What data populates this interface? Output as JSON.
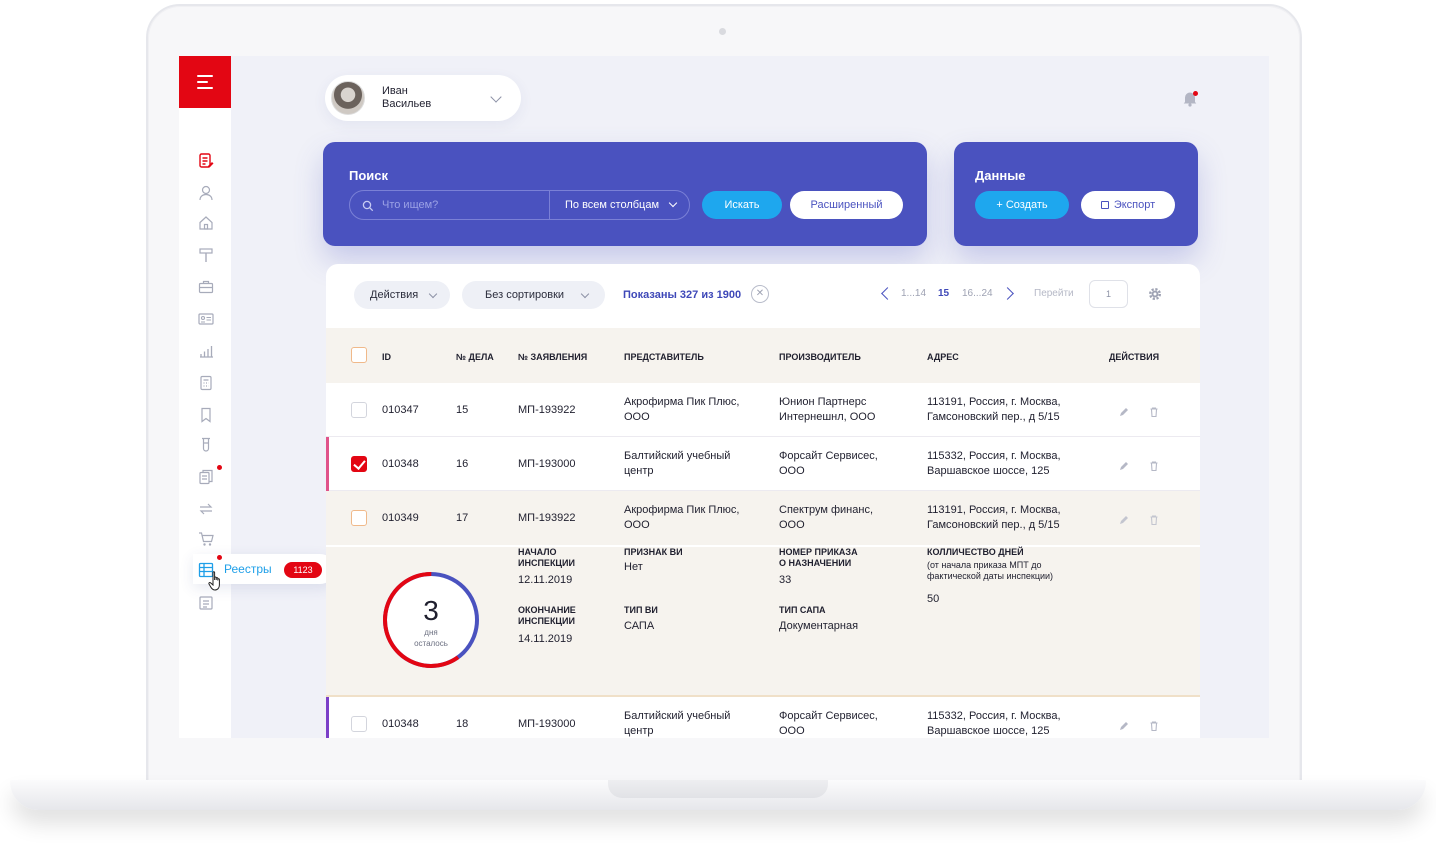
{
  "user": {
    "first_name": "Иван",
    "last_name": "Васильев"
  },
  "sidebar": {
    "active_label": "Реестры",
    "active_badge": "1123",
    "icons": [
      "document-edit-icon",
      "user-icon",
      "home-icon",
      "hammer-icon",
      "briefcase-icon",
      "id-card-icon",
      "bar-chart-icon",
      "calculator-icon",
      "bookmark-icon",
      "test-tube-icon",
      "documents-icon",
      "exchange-icon",
      "cart-icon",
      "registry-icon",
      "list-icon"
    ]
  },
  "search": {
    "title": "Поиск",
    "placeholder": "Что ищем?",
    "scope": "По всем столбцам",
    "find_label": "Искать",
    "advanced_label": "Расширенный"
  },
  "data_card": {
    "title": "Данные",
    "create_label": "+ Создать",
    "export_label": "Экспорт"
  },
  "toolbar": {
    "actions_label": "Действия",
    "sort_label": "Без сортировки",
    "shown_text": "Показаны 327 из 1900",
    "pages_before": "1...14",
    "current_page": "15",
    "pages_after": "16...24",
    "goto_label": "Перейти",
    "goto_value": "1"
  },
  "table": {
    "headers": [
      "ID",
      "№ ДЕЛА",
      "№ ЗАЯВЛЕНИЯ",
      "ПРЕДСТАВИТЕЛЬ",
      "ПРОИЗВОДИТЕЛЬ",
      "АДРЕС",
      "ДЕЙСТВИЯ"
    ],
    "rows": [
      {
        "id": "010347",
        "case": "15",
        "app": "МП-193922",
        "rep": [
          "Акрофирма Пик Плюс,",
          "ООО"
        ],
        "maker": [
          "Юнион Партнерс",
          "Интернешнл, ООО"
        ],
        "addr": [
          "113191, Россия, г. Москва,",
          "Гамсоновский пер., д 5/15"
        ]
      },
      {
        "id": "010348",
        "case": "16",
        "app": "МП-193000",
        "rep": [
          "Балтийский учебный",
          "центр"
        ],
        "maker": [
          "Форсайт Сервисес,",
          "ООО"
        ],
        "addr": [
          "115332, Россия, г. Москва,",
          "Варшавское шоссе, 125"
        ]
      },
      {
        "id": "010349",
        "case": "17",
        "app": "МП-193922",
        "rep": [
          "Акрофирма Пик Плюс,",
          "ООО"
        ],
        "maker": [
          "Спектрум финанс,",
          "ООО"
        ],
        "addr": [
          "113191, Россия, г. Москва,",
          "Гамсоновский пер., д 5/15"
        ]
      },
      {
        "id": "010348",
        "case": "18",
        "app": "МП-193000",
        "rep": [
          "Балтийский учебный",
          "центр"
        ],
        "maker": [
          "Форсайт Сервисес,",
          "ООО"
        ],
        "addr": [
          "115332, Россия, г. Москва,",
          "Варшавское шоссе, 125"
        ]
      }
    ]
  },
  "detail": {
    "days_left": "3",
    "days_word": "дня",
    "left_word": "осталось",
    "days_progress": 0.6,
    "start_label": [
      "НАЧАЛО",
      "ИНСПЕКЦИИ"
    ],
    "start_value": "12.11.2019",
    "end_label": [
      "ОКОНЧАНИЕ",
      "ИНСПЕКЦИИ"
    ],
    "end_value": "14.11.2019",
    "sign_label": "ПРИЗНАК ВИ",
    "sign_value": "Нет",
    "type_label": "ТИП ВИ",
    "type_value": "САПА",
    "order_label": [
      "НОМЕР ПРИКАЗА",
      "О НАЗНАЧЕНИИ"
    ],
    "order_value": "33",
    "sapa_label": "ТИП САПА",
    "sapa_value": "Документарная",
    "days_label": "КОЛЛИЧЕСТВО ДНЕЙ",
    "days_sub": [
      "(от начала приказа МПТ до",
      "фактической даты инспекции)"
    ],
    "days_value": "50"
  },
  "colors": {
    "accent": "#4a52bf",
    "brand_red": "#e30613",
    "action_blue": "#1ea7ee",
    "row_pink": "#e0538a",
    "row_purple": "#7b3fc8"
  }
}
